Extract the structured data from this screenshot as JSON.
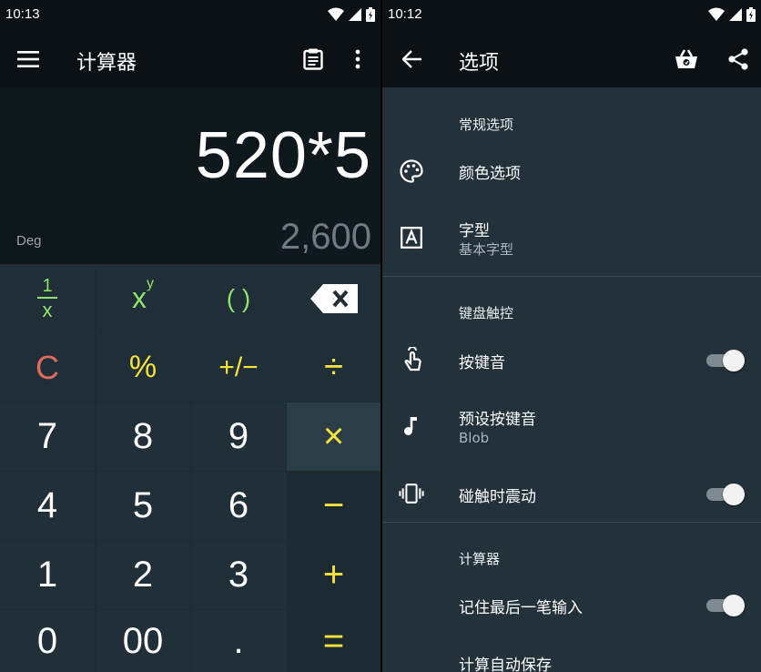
{
  "left": {
    "status": {
      "time": "10:13"
    },
    "toolbar": {
      "title": "计算器"
    },
    "display": {
      "expression": "520*5",
      "result": "2,600",
      "mode": "Deg"
    },
    "keys": {
      "reciprocal_num": "1",
      "reciprocal_den": "x",
      "power_base": "x",
      "power_exp": "y",
      "parens": "( )",
      "clear": "C",
      "percent": "%",
      "plus_minus": "+/−",
      "divide": "÷",
      "multiply": "×",
      "minus": "−",
      "plus": "+",
      "equals": "=",
      "dot": ".",
      "zero": "0",
      "double_zero": "00",
      "n1": "1",
      "n2": "2",
      "n3": "3",
      "n4": "4",
      "n5": "5",
      "n6": "6",
      "n7": "7",
      "n8": "8",
      "n9": "9"
    },
    "colors": {
      "accent_yellow": "#f4e33a",
      "accent_green": "#8fe36a",
      "clear_red": "#e06a5c"
    }
  },
  "right": {
    "status": {
      "time": "10:12"
    },
    "toolbar": {
      "title": "选项"
    },
    "sections": {
      "general": "常规选项",
      "keyboard": "键盘触控",
      "calculator": "计算器"
    },
    "items": {
      "color": {
        "title": "颜色选项"
      },
      "font": {
        "title": "字型",
        "subtitle": "基本字型"
      },
      "key_sound": {
        "title": "按键音",
        "enabled": true
      },
      "preset_sound": {
        "title": "预设按键音",
        "subtitle": "Blob"
      },
      "vibrate": {
        "title": "碰触时震动",
        "enabled": true
      },
      "remember_input": {
        "title": "记住最后一笔输入",
        "enabled": true
      },
      "autosave": {
        "title": "计算自动保存"
      }
    }
  }
}
